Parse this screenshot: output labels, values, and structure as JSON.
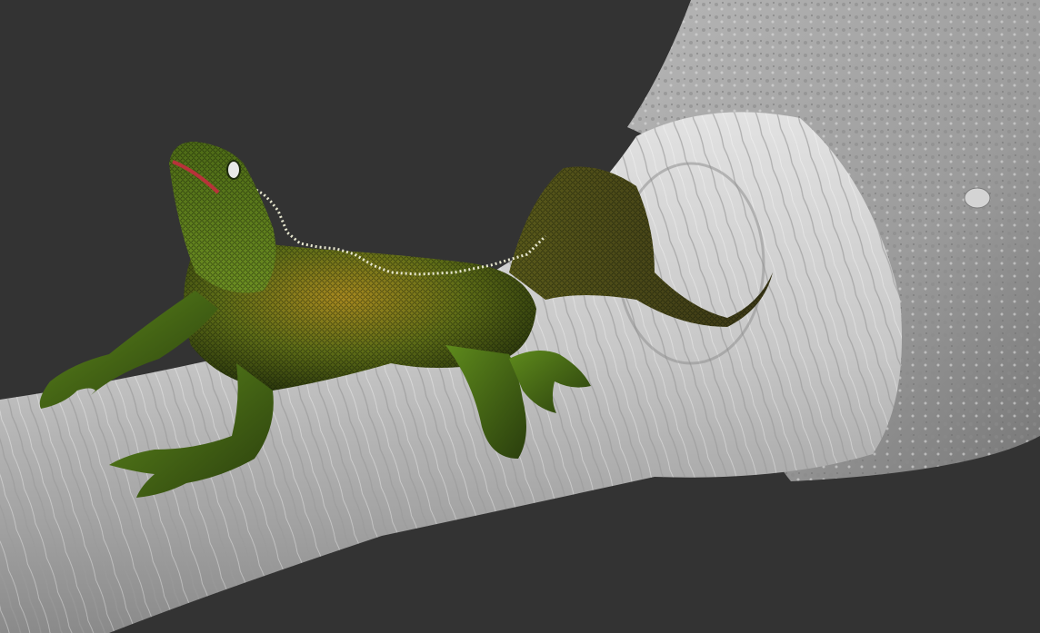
{
  "viewport": {
    "background_color": "#333333",
    "render_mode": "sculpt-preview"
  },
  "scene": {
    "objects": [
      {
        "name": "branch",
        "material": "matcap-gray",
        "color": "#c9c9c9"
      },
      {
        "name": "iguana",
        "material": "painted-scales",
        "colors": [
          "#2f4a12",
          "#6f8a1e",
          "#b88a1a",
          "#1d2a0b"
        ]
      }
    ]
  }
}
